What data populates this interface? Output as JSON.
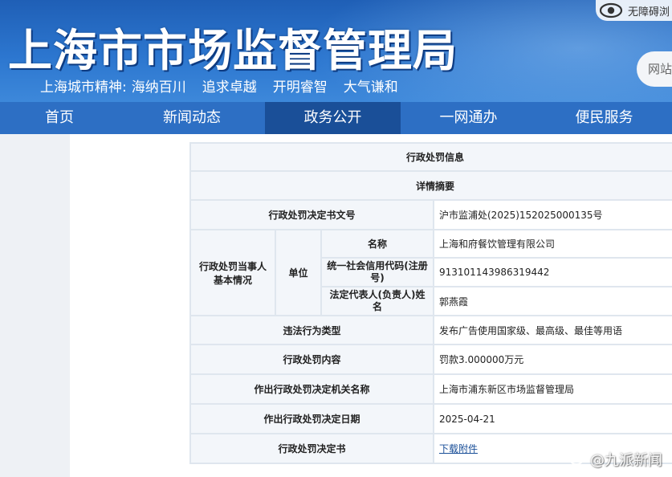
{
  "header": {
    "site_title": "上海市市场监督管理局",
    "city_spirit_label": "上海城市精神:",
    "city_spirit_items": [
      "海纳百川",
      "追求卓越",
      "开明睿智",
      "大气谦和"
    ],
    "accessibility_label": "无障碍浏",
    "search_placeholder": "网站"
  },
  "nav": {
    "items": [
      {
        "label": "首页"
      },
      {
        "label": "新闻动态"
      },
      {
        "label": "政务公开"
      },
      {
        "label": "一网通办"
      },
      {
        "label": "便民服务"
      }
    ],
    "active_index": 2
  },
  "record": {
    "section_title": "行政处罚信息",
    "summary_title": "详情摘要",
    "rows": {
      "doc_no_label": "行政处罚决定书文号",
      "doc_no_value": "沪市监浦处(2025)152025000135号",
      "party_label": "行政处罚当事人基本情况",
      "unit_label": "单位",
      "name_label": "名称",
      "name_value": "上海和府餐饮管理有限公司",
      "credit_code_label": "统一社会信用代码(注册号)",
      "credit_code_value": "913101143986319442",
      "legal_rep_label": "法定代表人(负责人)姓名",
      "legal_rep_value": "郭燕霞",
      "violation_type_label": "违法行为类型",
      "violation_type_value": "发布广告使用国家级、最高级、最佳等用语",
      "penalty_content_label": "行政处罚内容",
      "penalty_content_value": "罚款3.000000万元",
      "authority_label": "作出行政处罚决定机关名称",
      "authority_value": "上海市浦东新区市场监督管理局",
      "decision_date_label": "作出行政处罚决定日期",
      "decision_date_value": "2025-04-21",
      "decision_doc_label": "行政处罚决定书",
      "decision_doc_link": "下载附件"
    }
  },
  "watermark": {
    "text": "@九派新闻"
  },
  "colors": {
    "banner": "#2c76cf",
    "nav": "#2d6fc4",
    "nav_active": "#1a4f98",
    "label_bg": "#f3f6fa",
    "border": "#dfe6ee"
  }
}
